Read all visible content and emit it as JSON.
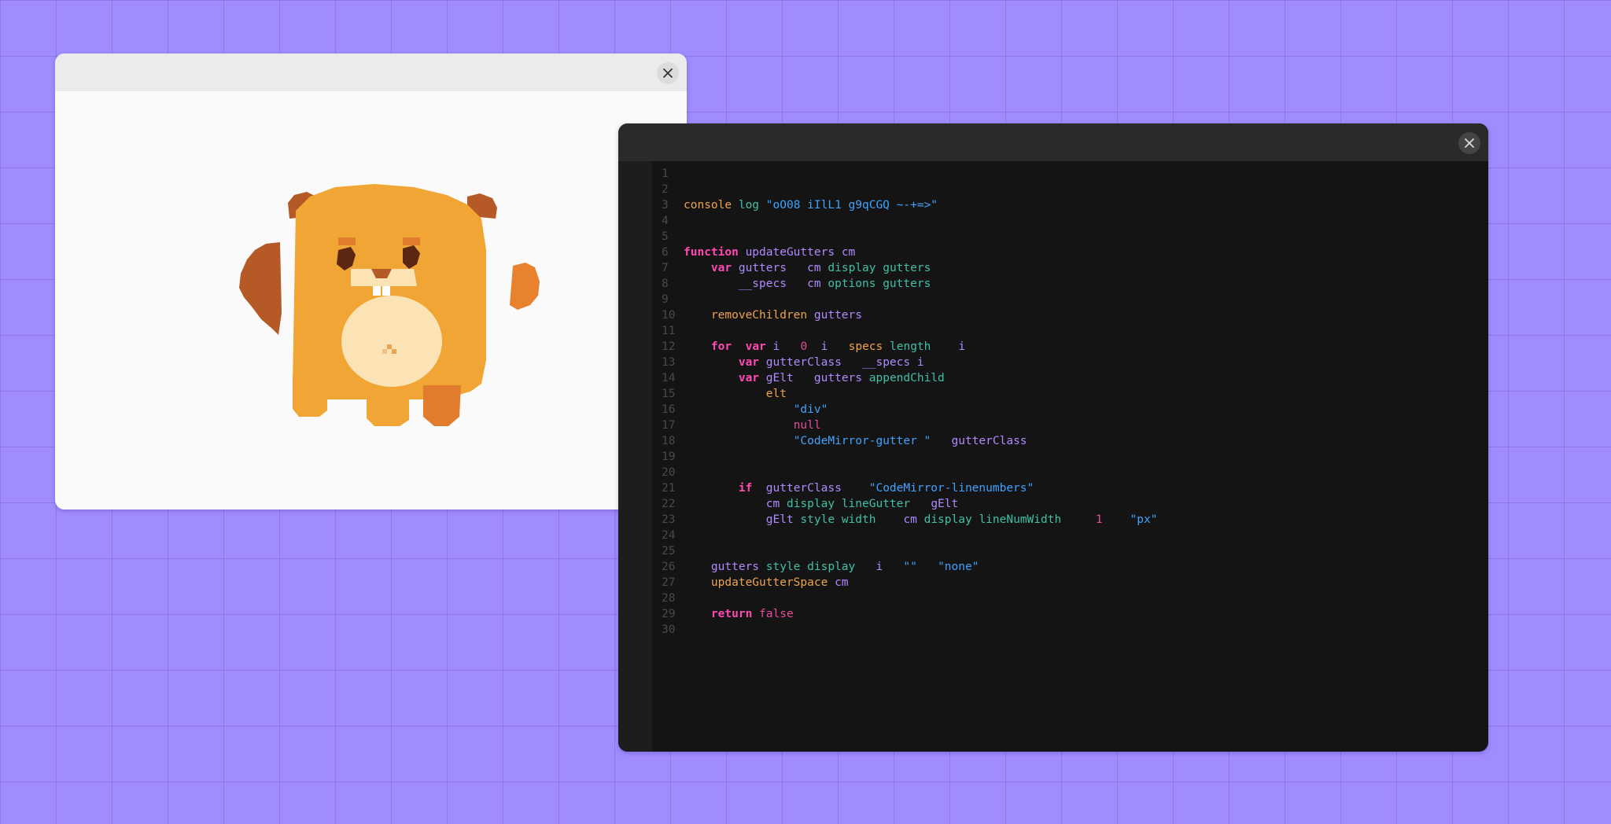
{
  "image_window": {
    "close_icon": "close-icon",
    "image": "beaver-mascot-pixel-art"
  },
  "editor_window": {
    "close_icon": "close-icon",
    "line_numbers": [
      "1",
      "2",
      "3",
      "4",
      "5",
      "6",
      "7",
      "8",
      "9",
      "10",
      "11",
      "12",
      "13",
      "14",
      "15",
      "16",
      "17",
      "18",
      "19",
      "20",
      "21",
      "22",
      "23",
      "24",
      "25",
      "26",
      "27",
      "28",
      "29",
      "30"
    ],
    "code": {
      "console": "console",
      "log": "log",
      "log_string": "\"oO08 iIlL1 g9qCGQ ~-+=>\"",
      "function_kw": "function",
      "update_gutters": "updateGutters",
      "cm": "cm",
      "var_kw": "var",
      "gutters": "gutters",
      "display": "display",
      "specs": "__specs",
      "options": "options",
      "remove_children": "removeChildren",
      "for_kw": "for",
      "i": "i",
      "zero": "0",
      "specs_short": "specs",
      "length": "length",
      "gutter_class": "gutterClass",
      "g_elt": "gElt",
      "append_child": "appendChild",
      "elt": "elt",
      "div_string": "\"div\"",
      "null_kw": "null",
      "codemirror_gutter_string": "\"CodeMirror-gutter \"",
      "if_kw": "if",
      "linenumbers_string": "\"CodeMirror-linenumbers\"",
      "line_gutter": "lineGutter",
      "style": "style",
      "width": "width",
      "line_num_width": "lineNumWidth",
      "one": "1",
      "px_string": "\"px\"",
      "empty_string": "\"\"",
      "none_string": "\"none\"",
      "update_gutter_space": "updateGutterSpace",
      "return_kw": "return",
      "false_kw": "false"
    }
  },
  "colors": {
    "background": "#a18cff",
    "editor_bg": "#141414",
    "keyword": "#ff49b5",
    "function": "#f0a34a",
    "variable": "#b089ff",
    "property": "#3fc0a6",
    "string": "#3ea3ff"
  }
}
